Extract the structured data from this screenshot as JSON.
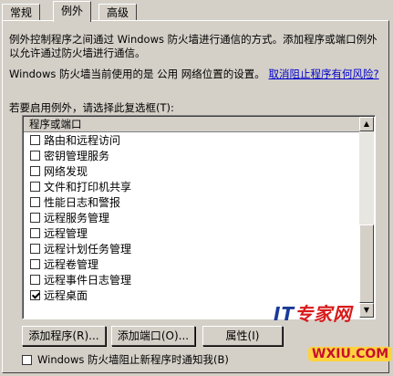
{
  "tabs": [
    "常规",
    "例外",
    "高级"
  ],
  "active_tab": "例外",
  "description": "例外控制程序之间通过 Windows 防火墙进行通信的方式。添加程序或端口例外以允许通过防火墙进行通信。",
  "location": {
    "text": "Windows 防火墙当前使用的是 公用 网络位置的设置。",
    "link": "取消阻止程序有何风险?"
  },
  "prompt": "若要启用例外，请选择此复选框(T):",
  "list": {
    "header": "程序或端口",
    "items": [
      {
        "label": "路由和远程访问",
        "checked": false
      },
      {
        "label": "密钥管理服务",
        "checked": false
      },
      {
        "label": "网络发现",
        "checked": false
      },
      {
        "label": "文件和打印机共享",
        "checked": false
      },
      {
        "label": "性能日志和警报",
        "checked": false
      },
      {
        "label": "远程服务管理",
        "checked": false
      },
      {
        "label": "远程管理",
        "checked": false
      },
      {
        "label": "远程计划任务管理",
        "checked": false
      },
      {
        "label": "远程卷管理",
        "checked": false
      },
      {
        "label": "远程事件日志管理",
        "checked": false
      },
      {
        "label": "远程桌面",
        "checked": true
      }
    ]
  },
  "buttons": {
    "add_program": "添加程序(R)...",
    "add_port": "添加端口(O)...",
    "properties": "属性(I)"
  },
  "notify": {
    "label": "Windows 防火墙阻止新程序时通知我(B)",
    "checked": false
  },
  "watermark": {
    "brand_it": "IT",
    "brand_rest": "专家网",
    "site": "WXIU.COM"
  }
}
